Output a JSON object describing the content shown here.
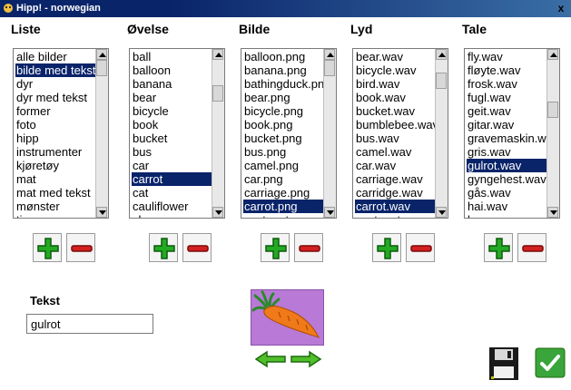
{
  "window": {
    "title": "Hipp! - norwegian",
    "close_label": "x"
  },
  "columns": [
    {
      "label": "Liste",
      "items": [
        "alle bilder",
        "bilde med tekst",
        "dyr",
        "dyr med tekst",
        "former",
        "foto",
        "hipp",
        "instrumenter",
        "kjøretøy",
        "mat",
        "mat med tekst",
        "mønster",
        "ting"
      ],
      "selected": "bilde med tekst"
    },
    {
      "label": "Øvelse",
      "items": [
        "ball",
        "balloon",
        "banana",
        "bear",
        "bicycle",
        "book",
        "bucket",
        "bus",
        "car",
        "carrot",
        "cat",
        "cauliflower",
        "cherry"
      ],
      "selected": "carrot"
    },
    {
      "label": "Bilde",
      "items": [
        "balloon.png",
        "banana.png",
        "bathingduck.png",
        "bear.png",
        "bicycle.png",
        "book.png",
        "bucket.png",
        "bus.png",
        "camel.png",
        "car.png",
        "carriage.png",
        "carrot.png",
        "castanet.png"
      ],
      "selected": "carrot.png"
    },
    {
      "label": "Lyd",
      "items": [
        "bear.wav",
        "bicycle.wav",
        "bird.wav",
        "book.wav",
        "bucket.wav",
        "bumblebee.wav",
        "bus.wav",
        "camel.wav",
        "car.wav",
        "carriage.wav",
        "carridge.wav",
        "carrot.wav",
        "castanet.wav"
      ],
      "selected": "carrot.wav"
    },
    {
      "label": "Tale",
      "items": [
        "fly.wav",
        "fløyte.wav",
        "frosk.wav",
        "fugl.wav",
        "geit.wav",
        "gitar.wav",
        "gravemaskin.wav",
        "gris.wav",
        "gulrot.wav",
        "gyngehest.wav",
        "gås.wav",
        "hai.wav",
        "hane.wav"
      ],
      "selected": "gulrot.wav"
    }
  ],
  "text_field": {
    "label": "Tekst",
    "value": "gulrot"
  },
  "icons": {
    "add": "plus-icon",
    "remove": "minus-icon",
    "prev": "arrow-left-icon",
    "next": "arrow-right-icon",
    "save": "floppy-disk-icon",
    "ok": "checkmark-icon",
    "picture": "carrot-icon"
  },
  "colors": {
    "selection": "#0a246a",
    "add": "#22aa22",
    "remove": "#d42020",
    "image_bg": "#b87ad6",
    "ok": "#3aa53a"
  }
}
